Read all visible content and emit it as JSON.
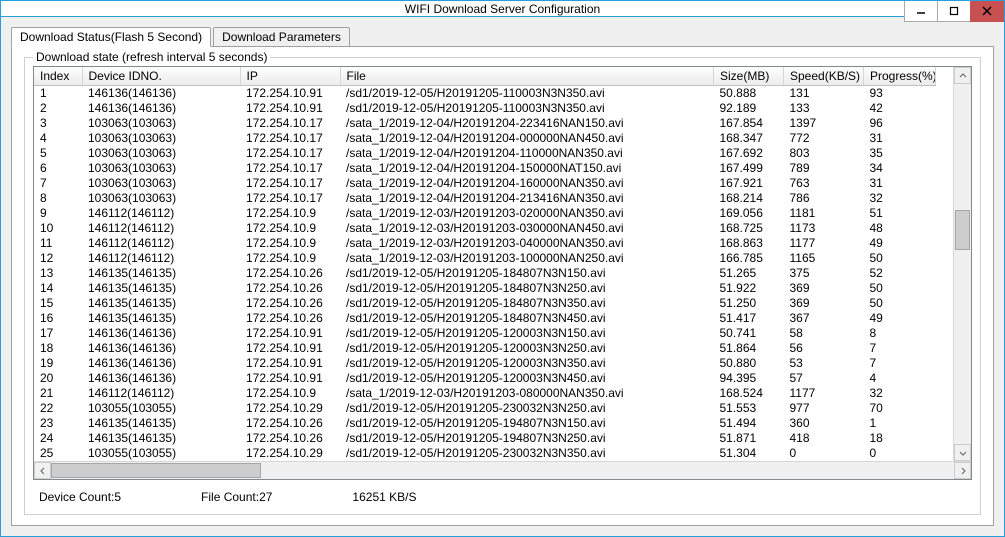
{
  "window": {
    "title": "WIFI Download Server Configuration"
  },
  "tabs": {
    "active": "Download Status(Flash 5 Second)",
    "inactive": "Download Parameters"
  },
  "group": {
    "label": "Download state (refresh interval 5 seconds)"
  },
  "columns": {
    "index": "Index",
    "device": "Device IDNO.",
    "ip": "IP",
    "file": "File",
    "size": "Size(MB)",
    "speed": "Speed(KB/S)",
    "progress": "Progress(%)"
  },
  "rows": [
    {
      "index": "1",
      "device": "146136(146136)",
      "ip": "172.254.10.91",
      "file": "/sd1/2019-12-05/H20191205-110003N3N350.avi",
      "size": "50.888",
      "speed": "131",
      "progress": "93"
    },
    {
      "index": "2",
      "device": "146136(146136)",
      "ip": "172.254.10.91",
      "file": "/sd1/2019-12-05/H20191205-110003N3N350.avi",
      "size": "92.189",
      "speed": "133",
      "progress": "42"
    },
    {
      "index": "3",
      "device": "103063(103063)",
      "ip": "172.254.10.17",
      "file": "/sata_1/2019-12-04/H20191204-223416NAN150.avi",
      "size": "167.854",
      "speed": "1397",
      "progress": "96"
    },
    {
      "index": "4",
      "device": "103063(103063)",
      "ip": "172.254.10.17",
      "file": "/sata_1/2019-12-04/H20191204-000000NAN450.avi",
      "size": "168.347",
      "speed": "772",
      "progress": "31"
    },
    {
      "index": "5",
      "device": "103063(103063)",
      "ip": "172.254.10.17",
      "file": "/sata_1/2019-12-04/H20191204-110000NAN350.avi",
      "size": "167.692",
      "speed": "803",
      "progress": "35"
    },
    {
      "index": "6",
      "device": "103063(103063)",
      "ip": "172.254.10.17",
      "file": "/sata_1/2019-12-04/H20191204-150000NAT150.avi",
      "size": "167.499",
      "speed": "789",
      "progress": "34"
    },
    {
      "index": "7",
      "device": "103063(103063)",
      "ip": "172.254.10.17",
      "file": "/sata_1/2019-12-04/H20191204-160000NAN350.avi",
      "size": "167.921",
      "speed": "763",
      "progress": "31"
    },
    {
      "index": "8",
      "device": "103063(103063)",
      "ip": "172.254.10.17",
      "file": "/sata_1/2019-12-04/H20191204-213416NAN350.avi",
      "size": "168.214",
      "speed": "786",
      "progress": "32"
    },
    {
      "index": "9",
      "device": "146112(146112)",
      "ip": "172.254.10.9",
      "file": "/sata_1/2019-12-03/H20191203-020000NAN350.avi",
      "size": "169.056",
      "speed": "1181",
      "progress": "51"
    },
    {
      "index": "10",
      "device": "146112(146112)",
      "ip": "172.254.10.9",
      "file": "/sata_1/2019-12-03/H20191203-030000NAN450.avi",
      "size": "168.725",
      "speed": "1173",
      "progress": "48"
    },
    {
      "index": "11",
      "device": "146112(146112)",
      "ip": "172.254.10.9",
      "file": "/sata_1/2019-12-03/H20191203-040000NAN350.avi",
      "size": "168.863",
      "speed": "1177",
      "progress": "49"
    },
    {
      "index": "12",
      "device": "146112(146112)",
      "ip": "172.254.10.9",
      "file": "/sata_1/2019-12-03/H20191203-100000NAN250.avi",
      "size": "166.785",
      "speed": "1165",
      "progress": "50"
    },
    {
      "index": "13",
      "device": "146135(146135)",
      "ip": "172.254.10.26",
      "file": "/sd1/2019-12-05/H20191205-184807N3N150.avi",
      "size": "51.265",
      "speed": "375",
      "progress": "52"
    },
    {
      "index": "14",
      "device": "146135(146135)",
      "ip": "172.254.10.26",
      "file": "/sd1/2019-12-05/H20191205-184807N3N250.avi",
      "size": "51.922",
      "speed": "369",
      "progress": "50"
    },
    {
      "index": "15",
      "device": "146135(146135)",
      "ip": "172.254.10.26",
      "file": "/sd1/2019-12-05/H20191205-184807N3N350.avi",
      "size": "51.250",
      "speed": "369",
      "progress": "50"
    },
    {
      "index": "16",
      "device": "146135(146135)",
      "ip": "172.254.10.26",
      "file": "/sd1/2019-12-05/H20191205-184807N3N450.avi",
      "size": "51.417",
      "speed": "367",
      "progress": "49"
    },
    {
      "index": "17",
      "device": "146136(146136)",
      "ip": "172.254.10.91",
      "file": "/sd1/2019-12-05/H20191205-120003N3N150.avi",
      "size": "50.741",
      "speed": "58",
      "progress": "8"
    },
    {
      "index": "18",
      "device": "146136(146136)",
      "ip": "172.254.10.91",
      "file": "/sd1/2019-12-05/H20191205-120003N3N250.avi",
      "size": "51.864",
      "speed": "56",
      "progress": "7"
    },
    {
      "index": "19",
      "device": "146136(146136)",
      "ip": "172.254.10.91",
      "file": "/sd1/2019-12-05/H20191205-120003N3N350.avi",
      "size": "50.880",
      "speed": "53",
      "progress": "7"
    },
    {
      "index": "20",
      "device": "146136(146136)",
      "ip": "172.254.10.91",
      "file": "/sd1/2019-12-05/H20191205-120003N3N450.avi",
      "size": "94.395",
      "speed": "57",
      "progress": "4"
    },
    {
      "index": "21",
      "device": "146112(146112)",
      "ip": "172.254.10.9",
      "file": "/sata_1/2019-12-03/H20191203-080000NAN350.avi",
      "size": "168.524",
      "speed": "1177",
      "progress": "32"
    },
    {
      "index": "22",
      "device": "103055(103055)",
      "ip": "172.254.10.29",
      "file": "/sd1/2019-12-05/H20191205-230032N3N250.avi",
      "size": "51.553",
      "speed": "977",
      "progress": "70"
    },
    {
      "index": "23",
      "device": "146135(146135)",
      "ip": "172.254.10.26",
      "file": "/sd1/2019-12-05/H20191205-194807N3N150.avi",
      "size": "51.494",
      "speed": "360",
      "progress": "1"
    },
    {
      "index": "24",
      "device": "146135(146135)",
      "ip": "172.254.10.26",
      "file": "/sd1/2019-12-05/H20191205-194807N3N250.avi",
      "size": "51.871",
      "speed": "418",
      "progress": "18"
    },
    {
      "index": "25",
      "device": "103055(103055)",
      "ip": "172.254.10.29",
      "file": "/sd1/2019-12-05/H20191205-230032N3N350.avi",
      "size": "51.304",
      "speed": "0",
      "progress": "0"
    }
  ],
  "status": {
    "device_count": "Device Count:5",
    "file_count": "File Count:27",
    "speed_total": "16251 KB/S"
  }
}
